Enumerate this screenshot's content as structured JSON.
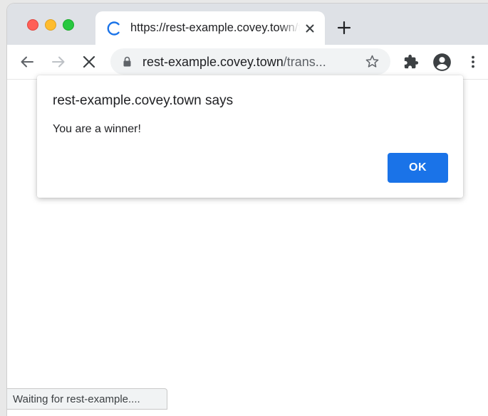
{
  "browser": {
    "tab": {
      "title": "https://rest-example.covey.town/transfer",
      "spinner_icon": "loading-spinner-icon",
      "close_icon": "close-icon"
    },
    "new_tab_icon": "plus-icon",
    "toolbar": {
      "back_icon": "arrow-left-icon",
      "forward_icon": "arrow-right-icon",
      "stop_icon": "close-icon",
      "extensions_icon": "puzzle-icon",
      "profile_icon": "account-circle-icon",
      "menu_icon": "more-vertical-icon"
    },
    "omnibox": {
      "url_host": "rest-example.covey.town",
      "url_path": "/trans...",
      "lock_icon": "lock-icon",
      "bookmark_icon": "star-outline-icon"
    }
  },
  "dialog": {
    "title": "rest-example.covey.town says",
    "message": "You are a winner!",
    "ok_label": "OK"
  },
  "status": {
    "text": "Waiting for rest-example...."
  },
  "colors": {
    "accent": "#1a73e8",
    "tabstrip": "#dee1e6",
    "omnibox": "#f1f3f4",
    "traffic_red": "#ff5f57",
    "traffic_yellow": "#febc2e",
    "traffic_green": "#28c840"
  }
}
